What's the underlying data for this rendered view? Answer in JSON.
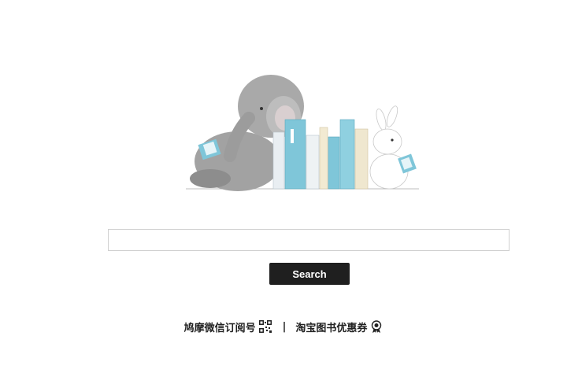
{
  "search": {
    "value": "",
    "placeholder": "",
    "button_label": "Search"
  },
  "footer": {
    "wechat_label": "鸠摩微信订阅号",
    "separator": "|",
    "taobao_label": "淘宝图书优惠券"
  },
  "icons": {
    "wechat": "qr-code-icon",
    "taobao": "coupon-badge-icon"
  },
  "colors": {
    "button_bg": "#1f1f1f",
    "button_text": "#ffffff",
    "book_blue": "#7fc6d9",
    "book_cream": "#efe7cf",
    "elephant_gray": "#9a9a9a"
  }
}
